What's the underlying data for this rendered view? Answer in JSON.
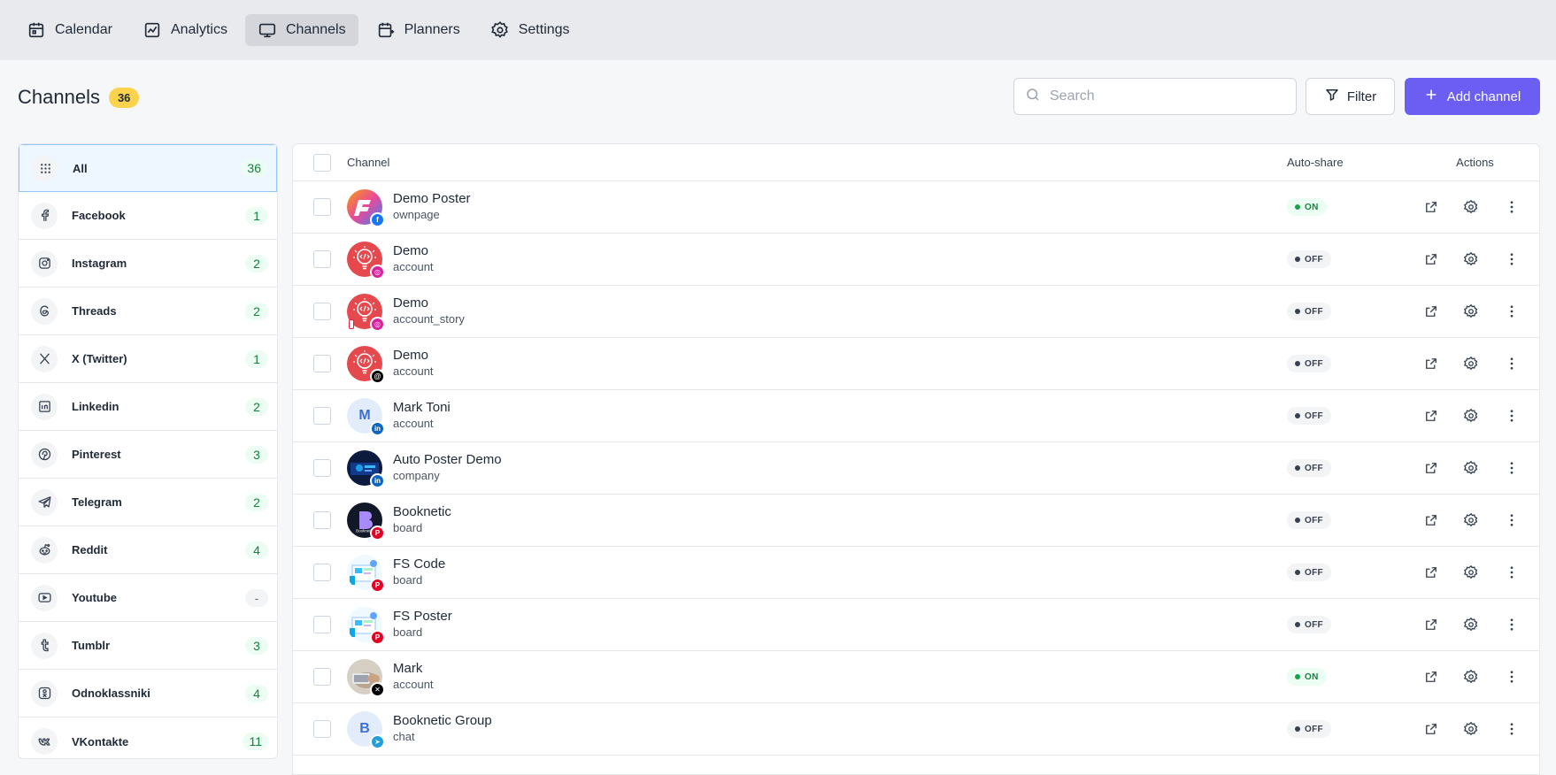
{
  "nav": [
    {
      "label": "Calendar",
      "icon": "calendar-icon"
    },
    {
      "label": "Analytics",
      "icon": "analytics-icon"
    },
    {
      "label": "Channels",
      "icon": "monitor-icon",
      "active": true
    },
    {
      "label": "Planners",
      "icon": "planner-icon"
    },
    {
      "label": "Settings",
      "icon": "gear-icon"
    }
  ],
  "header": {
    "title": "Channels",
    "count": "36"
  },
  "search": {
    "placeholder": "Search"
  },
  "filter_label": "Filter",
  "add_label": "Add channel",
  "sidebar": [
    {
      "label": "All",
      "count": "36",
      "icon": "grid-icon"
    },
    {
      "label": "Facebook",
      "count": "1",
      "icon": "facebook-icon"
    },
    {
      "label": "Instagram",
      "count": "2",
      "icon": "instagram-icon"
    },
    {
      "label": "Threads",
      "count": "2",
      "icon": "threads-icon"
    },
    {
      "label": "X (Twitter)",
      "count": "1",
      "icon": "x-icon"
    },
    {
      "label": "Linkedin",
      "count": "2",
      "icon": "linkedin-icon"
    },
    {
      "label": "Pinterest",
      "count": "3",
      "icon": "pinterest-icon"
    },
    {
      "label": "Telegram",
      "count": "2",
      "icon": "telegram-icon"
    },
    {
      "label": "Reddit",
      "count": "4",
      "icon": "reddit-icon"
    },
    {
      "label": "Youtube",
      "count": "-",
      "icon": "youtube-icon"
    },
    {
      "label": "Tumblr",
      "count": "3",
      "icon": "tumblr-icon"
    },
    {
      "label": "Odnoklassniki",
      "count": "4",
      "icon": "odnoklassniki-icon"
    },
    {
      "label": "VKontakte",
      "count": "11",
      "icon": "vkontakte-icon"
    }
  ],
  "table": {
    "headers": {
      "channel": "Channel",
      "autoshare": "Auto-share",
      "actions": "Actions"
    },
    "rows": [
      {
        "name": "Demo Poster",
        "sub": "ownpage",
        "platform": "facebook",
        "status": "ON",
        "avatar": "fs-logo"
      },
      {
        "name": "Demo",
        "sub": "account",
        "platform": "instagram",
        "status": "OFF",
        "avatar": "bulb"
      },
      {
        "name": "Demo",
        "sub": "account_story",
        "platform": "instagram",
        "status": "OFF",
        "avatar": "bulb",
        "story": true
      },
      {
        "name": "Demo",
        "sub": "account",
        "platform": "threads",
        "status": "OFF",
        "avatar": "bulb"
      },
      {
        "name": "Mark Toni",
        "sub": "account",
        "platform": "linkedin",
        "status": "OFF",
        "avatar": "letter",
        "letter": "M"
      },
      {
        "name": "Auto Poster Demo",
        "sub": "company",
        "platform": "linkedin",
        "status": "OFF",
        "avatar": "dark-blue"
      },
      {
        "name": "Booknetic",
        "sub": "board",
        "platform": "pinterest",
        "status": "OFF",
        "avatar": "booknetic"
      },
      {
        "name": "FS Code",
        "sub": "board",
        "platform": "pinterest",
        "status": "OFF",
        "avatar": "illustration"
      },
      {
        "name": "FS Poster",
        "sub": "board",
        "platform": "pinterest",
        "status": "OFF",
        "avatar": "illustration"
      },
      {
        "name": "Mark",
        "sub": "account",
        "platform": "x",
        "status": "ON",
        "avatar": "photo"
      },
      {
        "name": "Booknetic Group",
        "sub": "chat",
        "platform": "telegram",
        "status": "OFF",
        "avatar": "letter",
        "letter": "B"
      }
    ]
  },
  "colors": {
    "accent": "#6d5ef3",
    "badge": "#fcd34d",
    "on": "#16a34a",
    "facebook": "#1877f2",
    "instagram": "#d6249f",
    "linkedin": "#0a66c2",
    "pinterest": "#e60023",
    "telegram": "#229ed9",
    "x": "#000000",
    "threads": "#000000"
  }
}
